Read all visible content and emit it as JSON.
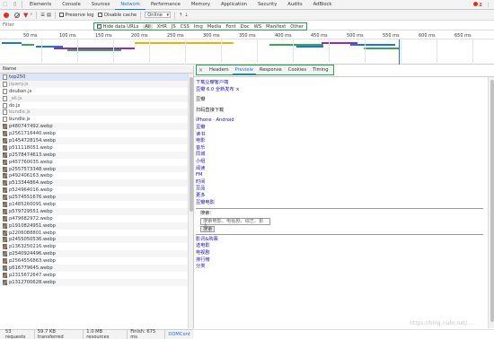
{
  "devtools_tabs": {
    "items": [
      "Elements",
      "Console",
      "Sources",
      "Network",
      "Performance",
      "Memory",
      "Application",
      "Security",
      "Audits",
      "AdBlock"
    ],
    "active": "Network",
    "error_count": "2"
  },
  "toolbar": {
    "preserve_log": "Preserve log",
    "disable_cache": "Disable cache",
    "throttle": "Online"
  },
  "filter": {
    "placeholder": "Filter",
    "hide_data_urls": "Hide data URLs",
    "types": [
      "All",
      "XHR",
      "JS",
      "CSS",
      "Img",
      "Media",
      "Font",
      "Doc",
      "WS",
      "Manifest",
      "Other"
    ]
  },
  "timeline": {
    "ticks": [
      "50 ms",
      "100 ms",
      "150 ms",
      "200 ms",
      "250 ms",
      "300 ms",
      "350 ms",
      "400 ms",
      "450 ms",
      "500 ms",
      "550 ms",
      "600 ms",
      "650 ms"
    ]
  },
  "request_list": {
    "column_name": "Name",
    "files": [
      {
        "name": "top250",
        "icon": "doc"
      },
      {
        "name": "jquery.js",
        "icon": "doc",
        "dim": true
      },
      {
        "name": "douban.js",
        "icon": "doc"
      },
      {
        "name": "_all.js",
        "icon": "doc",
        "dim": true
      },
      {
        "name": "do.js",
        "icon": "doc"
      },
      {
        "name": "bundle.js",
        "icon": "doc",
        "dim": true
      },
      {
        "name": "bundle.js",
        "icon": "doc"
      },
      {
        "name": "p480747492.webp",
        "icon": "img"
      },
      {
        "name": "p2561716440.webp",
        "icon": "img"
      },
      {
        "name": "p1454728154.webp",
        "icon": "img"
      },
      {
        "name": "p511118051.webp",
        "icon": "img"
      },
      {
        "name": "p2578474613.webp",
        "icon": "img"
      },
      {
        "name": "p457760035.webp",
        "icon": "img"
      },
      {
        "name": "p2557573348.webp",
        "icon": "img"
      },
      {
        "name": "p492406163.webp",
        "icon": "img"
      },
      {
        "name": "p513344864.webp",
        "icon": "img"
      },
      {
        "name": "p524964016.webp",
        "icon": "img"
      },
      {
        "name": "p2574551676.webp",
        "icon": "img"
      },
      {
        "name": "p1485260091.webp",
        "icon": "img"
      },
      {
        "name": "p579729551.webp",
        "icon": "img"
      },
      {
        "name": "p479682972.webp",
        "icon": "img"
      },
      {
        "name": "p1910824951.webp",
        "icon": "img"
      },
      {
        "name": "p2206088801.webp",
        "icon": "img"
      },
      {
        "name": "p2455050536.webp",
        "icon": "img"
      },
      {
        "name": "p1363250216.webp",
        "icon": "img"
      },
      {
        "name": "p2540924496.webp",
        "icon": "img"
      },
      {
        "name": "p2564556863.webp",
        "icon": "img"
      },
      {
        "name": "p616779645.webp",
        "icon": "img"
      },
      {
        "name": "p2315672647.webp",
        "icon": "img"
      },
      {
        "name": "p1312700628.webp",
        "icon": "img"
      }
    ],
    "selected_index": 0
  },
  "detail": {
    "tabs": [
      "Headers",
      "Preview",
      "Response",
      "Cookies",
      "Timing"
    ],
    "active_tab": "Preview",
    "preview": {
      "lines": [
        {
          "text": "下载豆瓣客户端",
          "style": "link"
        },
        {
          "text": "豆瓣 6.0 全新发布 ×",
          "style": "link"
        },
        {
          "text": "",
          "style": "spacer"
        },
        {
          "text": "豆瓣",
          "style": "dark"
        },
        {
          "text": "",
          "style": "spacer"
        },
        {
          "text": "扫码直接下载",
          "style": "dark"
        },
        {
          "text": "",
          "style": "spacer"
        },
        {
          "text": "iPhone · Android",
          "style": "link"
        },
        {
          "text": "豆瓣",
          "style": "link"
        },
        {
          "text": "读书",
          "style": "link"
        },
        {
          "text": "电影",
          "style": "link"
        },
        {
          "text": "音乐",
          "style": "link"
        },
        {
          "text": "同城",
          "style": "link"
        },
        {
          "text": "小组",
          "style": "link"
        },
        {
          "text": "阅读",
          "style": "link"
        },
        {
          "text": "FM",
          "style": "link"
        },
        {
          "text": "时间",
          "style": "link"
        },
        {
          "text": "豆品",
          "style": "link"
        },
        {
          "text": "更多",
          "style": "link"
        },
        {
          "text": "豆瓣电影",
          "style": "link"
        }
      ],
      "search_label": "搜索：",
      "search_placeholder": "搜索电影、电视剧、综艺、影人",
      "search_button": "搜索",
      "bottom_links": [
        "影讯&购票",
        "选电影",
        "电视剧",
        "排行榜",
        "分类"
      ]
    }
  },
  "status_bar": {
    "requests": "53 requests",
    "transferred": "59.7 KB transferred",
    "resources": "1.0 MB resources",
    "finish": "Finish: 675 ms",
    "dom": "DOMCont"
  },
  "watermark": "https://blog.csdn.net/..."
}
